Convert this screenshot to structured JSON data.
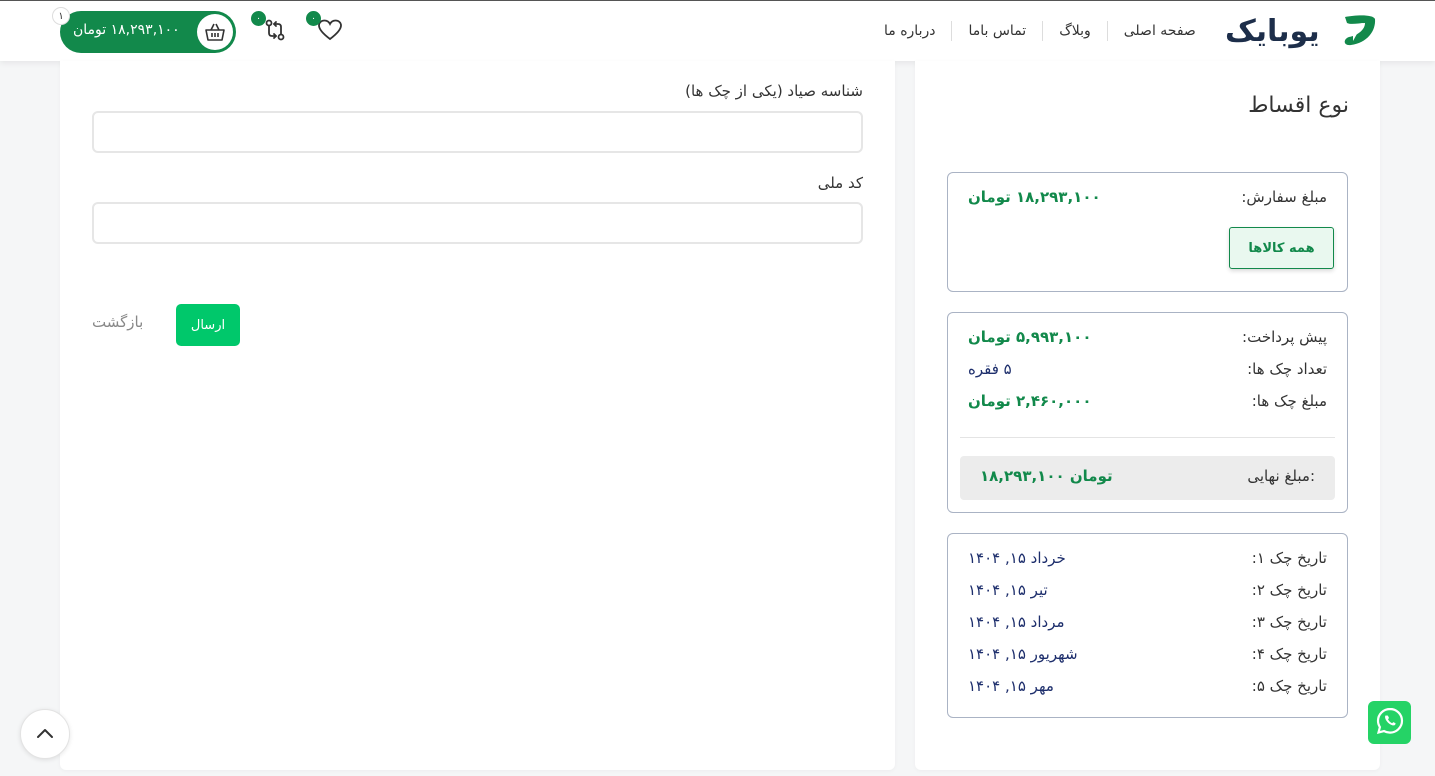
{
  "header": {
    "logo_text": "یوبایک",
    "nav": [
      "صفحه اصلی",
      "وبلاگ",
      "تماس باما",
      "درباره ما"
    ],
    "cart": {
      "total": "۱۸,۲۹۳,۱۰۰",
      "currency": "تومان",
      "count": "۱"
    },
    "compare_count": "۰",
    "wishlist_count": "۰",
    "brand_color": "#12894b"
  },
  "form": {
    "sayad_label": "شناسه صیاد (یکی از چک ها)",
    "sayad_value": "",
    "national_code_label": "کد ملی",
    "national_code_value": "",
    "submit_label": "ارسال",
    "back_label": "بازگشت"
  },
  "summary": {
    "title": "نوع اقساط",
    "order": {
      "label": "مبلغ سفارش:",
      "value": "۱۸,۲۹۳,۱۰۰ تومان",
      "all_items_button": "همه کالاها"
    },
    "payment": {
      "prepay_label": "پیش پرداخت:",
      "prepay_value": "۵,۹۹۳,۱۰۰ تومان",
      "checks_count_label": "تعداد چک ها:",
      "checks_count_value": "۵ فقره",
      "checks_amount_label": "مبلغ چک ها:",
      "checks_amount_value": "۲,۴۶۰,۰۰۰ تومان",
      "final_label": "مبلغ نهایی:",
      "final_value": "۱۸,۲۹۳,۱۰۰ تومان"
    },
    "dates": [
      {
        "label": "تاریخ چک ۱:",
        "value": "خرداد ۱۵, ۱۴۰۴"
      },
      {
        "label": "تاریخ چک ۲:",
        "value": "تیر ۱۵, ۱۴۰۴"
      },
      {
        "label": "تاریخ چک ۳:",
        "value": "مرداد ۱۵, ۱۴۰۴"
      },
      {
        "label": "تاریخ چک ۴:",
        "value": "شهریور ۱۵, ۱۴۰۴"
      },
      {
        "label": "تاریخ چک ۵:",
        "value": "مهر ۱۵, ۱۴۰۴"
      }
    ]
  },
  "icons": {
    "cart": "basket-icon",
    "compare": "compare-arrows-icon",
    "wishlist": "heart-icon",
    "scroll_top": "chevron-up-icon",
    "whatsapp": "whatsapp-icon"
  }
}
